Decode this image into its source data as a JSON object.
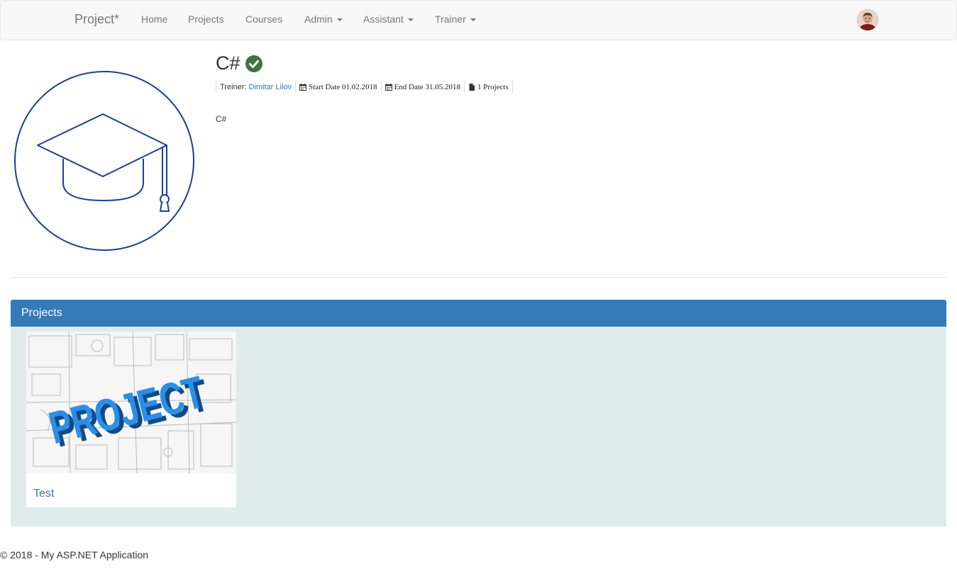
{
  "navbar": {
    "brand": "Project*",
    "items": [
      {
        "label": "Home",
        "dropdown": false
      },
      {
        "label": "Projects",
        "dropdown": false
      },
      {
        "label": "Courses",
        "dropdown": false
      },
      {
        "label": "Admin",
        "dropdown": true
      },
      {
        "label": "Assistant",
        "dropdown": true
      },
      {
        "label": "Trainer",
        "dropdown": true
      }
    ],
    "avatar_icon": "user-avatar"
  },
  "course": {
    "title": "C#",
    "status_icon": "check-circle-icon",
    "status_color": "#3c763d",
    "logo_icon": "graduation-cap-icon",
    "logo_color": "#1b3f94",
    "trainer_label": "Treiner:",
    "trainer_name": "Dimitar Lilov",
    "start_date_label": "Start Date 01.02.2018",
    "end_date_label": "End Date 31.05.2018",
    "projects_count_label": "1 Projects",
    "description": "C#"
  },
  "projects_panel": {
    "heading": "Projects",
    "accent": "#337ab7",
    "body_bg": "#e0ecec",
    "projects": [
      {
        "name": "Test",
        "image_text": "PROJECT"
      }
    ]
  },
  "footer": {
    "text": "© 2018 - My ASP.NET Application"
  }
}
